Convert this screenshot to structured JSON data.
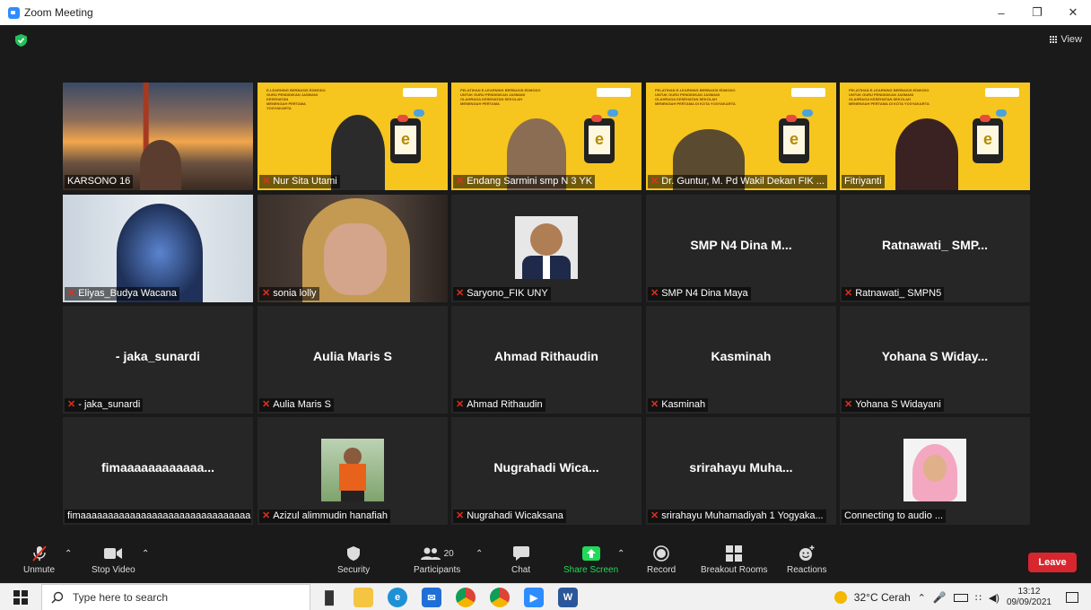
{
  "window": {
    "title": "Zoom Meeting",
    "controls": [
      "–",
      "❐",
      "✕"
    ]
  },
  "meeting": {
    "view_label": "View"
  },
  "tiles": [
    {
      "label": "KARSONO 16",
      "muted": false,
      "type": "video"
    },
    {
      "label": "Nur Sita Utami",
      "muted": true,
      "type": "slide"
    },
    {
      "label": "Endang Sarmini smp N 3 YK",
      "muted": true,
      "type": "slide"
    },
    {
      "label": "Dr. Guntur, M. Pd Wakil Dekan FIK ...",
      "muted": true,
      "type": "slide"
    },
    {
      "label": "Fitriyanti",
      "muted": false,
      "type": "slide",
      "active": true
    },
    {
      "label": "Eliyas_Budya Wacana",
      "muted": true,
      "type": "video"
    },
    {
      "label": "sonia lolly",
      "muted": true,
      "type": "video"
    },
    {
      "label": "Saryono_FIK UNY",
      "muted": true,
      "type": "photo"
    },
    {
      "big": "SMP N4 Dina M...",
      "label": "SMP N4 Dina Maya",
      "muted": true,
      "type": "name"
    },
    {
      "big": "Ratnawati_ SMP...",
      "label": "Ratnawati_ SMPN5",
      "muted": true,
      "type": "name"
    },
    {
      "big": "- jaka_sunardi",
      "label": "- jaka_sunardi",
      "muted": true,
      "type": "name"
    },
    {
      "big": "Aulia Maris S",
      "label": "Aulia Maris S",
      "muted": true,
      "type": "name"
    },
    {
      "big": "Ahmad Rithaudin",
      "label": "Ahmad Rithaudin",
      "muted": true,
      "type": "name"
    },
    {
      "big": "Kasminah",
      "label": "Kasminah",
      "muted": true,
      "type": "name"
    },
    {
      "big": "Yohana S Widay...",
      "label": "Yohana S Widayani",
      "muted": true,
      "type": "name"
    },
    {
      "big": "fimaaaaaaaaaaaa...",
      "label": "fimaaaaaaaaaaaaaaaaaaaaaaaaaaaaaaa...",
      "muted": false,
      "type": "name"
    },
    {
      "label": "Azizul alimmudin hanafiah",
      "muted": true,
      "type": "photo"
    },
    {
      "big": "Nugrahadi Wica...",
      "label": "Nugrahadi Wicaksana",
      "muted": true,
      "type": "name"
    },
    {
      "big": "srirahayu Muha...",
      "label": "srirahayu Muhamadiyah 1 Yogyaka...",
      "muted": true,
      "type": "name"
    },
    {
      "label": "Connecting to audio ...",
      "muted": false,
      "type": "photo"
    }
  ],
  "toolbar": {
    "unmute": "Unmute",
    "stop_video": "Stop Video",
    "security": "Security",
    "participants": "Participants",
    "participants_count": "20",
    "chat": "Chat",
    "share_screen": "Share Screen",
    "record": "Record",
    "breakout_rooms": "Breakout Rooms",
    "reactions": "Reactions",
    "leave": "Leave"
  },
  "taskbar": {
    "search_placeholder": "Type here to search",
    "weather": "32°C  Cerah",
    "time": "13:12",
    "date": "09/09/2021"
  },
  "colors": {
    "accent": "#2d8cff",
    "leave": "#d8262f",
    "active_speaker": "#d9dc36",
    "share": "#23d959",
    "slide_bg": "#f6c51e"
  }
}
